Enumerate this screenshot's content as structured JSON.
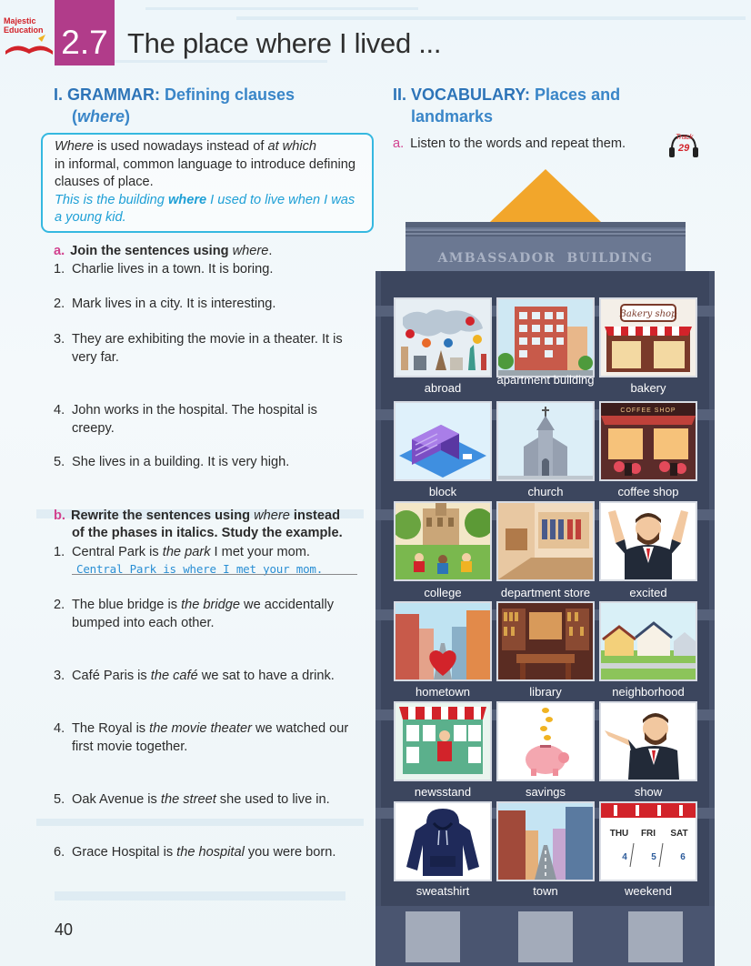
{
  "header": {
    "logo_line1": "Majestic",
    "logo_line2": "Education",
    "unit_number": "2.7",
    "title": "The place where I lived ..."
  },
  "grammar": {
    "heading_key": "I. GRAMMAR:",
    "heading_value": "Defining clauses",
    "heading_open": "(",
    "heading_word": "where",
    "heading_close": ")",
    "box": {
      "w1": "Where",
      "t1": " is used nowadays instead of ",
      "w2": "at which",
      "t2": "in informal, common language to introduce defining clauses of place.",
      "example_pre": "This is the building ",
      "example_bold": "where",
      "example_post": " I used to live when I was a young kid."
    },
    "task_a": {
      "letter": "a.",
      "text": "Join the sentences using ",
      "word": "where",
      "end": ".",
      "items": [
        {
          "n": "1.",
          "text": "Charlie lives in a town. It is boring."
        },
        {
          "n": "2.",
          "text": "Mark lives in a city. It is interesting."
        },
        {
          "n": "3.",
          "text": "They are exhibiting the movie in a theater. It is very far."
        },
        {
          "n": "4.",
          "text": "John works in the hospital. The hospital is creepy."
        },
        {
          "n": "5.",
          "text": "She lives in a building. It is very high."
        }
      ]
    },
    "task_b": {
      "letter": "b.",
      "text1": "Rewrite the sentences using ",
      "word": "where",
      "text2": " instead",
      "line2": "of the phases in italics. Study the example.",
      "example_answer": "Central Park is where I met your mom.",
      "items": [
        {
          "n": "1.",
          "pre": "Central Park is ",
          "it": "the park",
          "post": " I met your mom."
        },
        {
          "n": "2.",
          "pre": "The blue bridge is ",
          "it": "the bridge",
          "post": " we accidentally bumped into each other."
        },
        {
          "n": "3.",
          "pre": "Café Paris is ",
          "it": "the café",
          "post": " we sat to have a drink."
        },
        {
          "n": "4.",
          "pre": "The Royal is ",
          "it": "the movie theater",
          "post": " we watched our first movie together."
        },
        {
          "n": "5.",
          "pre": "Oak Avenue is ",
          "it": "the street",
          "post": " she used to live in."
        },
        {
          "n": "6.",
          "pre": "Grace Hospital is ",
          "it": "the hospital",
          "post": " you were born."
        }
      ]
    }
  },
  "vocabulary": {
    "heading_key": "II. VOCABULARY:",
    "heading_value": "Places and",
    "heading_line2": "landmarks",
    "task_a_letter": "a.",
    "task_a_text": "Listen to the words and repeat them.",
    "track_label": "Track",
    "track_number": "29",
    "building_sign_1": "AMBASSADOR",
    "building_sign_2": "BUILDING",
    "words": [
      "abroad",
      "apartment building",
      "bakery",
      "block",
      "church",
      "coffee shop",
      "college",
      "department store",
      "excited",
      "hometown",
      "library",
      "neighborhood",
      "newsstand",
      "savings",
      "show",
      "sweatshirt",
      "town",
      "weekend"
    ],
    "bakery_sign": "Bakery shop",
    "coffee_sign": "COFFEE SHOP",
    "calendar": {
      "days": [
        "THU",
        "FRI",
        "SAT"
      ],
      "dates": [
        "4",
        "5",
        "6"
      ]
    }
  },
  "page_number": "40",
  "colors": {
    "unit_box": "#b13c8a",
    "heading_blue": "#2d74b8",
    "accent_pink": "#d2428f",
    "example_cyan": "#1fa0d6",
    "building": "#3c465e"
  }
}
